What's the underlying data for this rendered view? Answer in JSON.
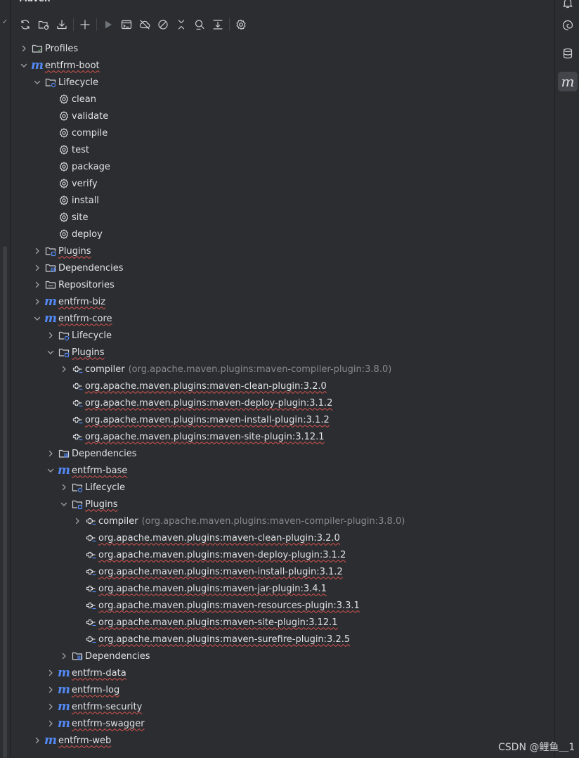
{
  "panel": {
    "title": "Maven"
  },
  "left_gutter": {
    "mark": "✓"
  },
  "toolbar": {
    "buttons": [
      {
        "name": "reload-all-projects",
        "icon": "reload-icon"
      },
      {
        "name": "generate-sources",
        "icon": "folder-reload-icon"
      },
      {
        "name": "download-sources",
        "icon": "download-icon"
      },
      {
        "name": "add-maven-project",
        "icon": "plus-icon"
      },
      {
        "name": "run-maven-build",
        "icon": "run-icon"
      },
      {
        "name": "execute-maven-goal",
        "icon": "terminal-icon"
      },
      {
        "name": "toggle-offline-mode",
        "icon": "cloud-off-icon"
      },
      {
        "name": "toggle-skip-tests",
        "icon": "skip-icon"
      },
      {
        "name": "collapse-all",
        "icon": "collapse-icon"
      },
      {
        "name": "show-dependencies",
        "icon": "analyze-icon"
      },
      {
        "name": "show-diagram",
        "icon": "diagram-icon"
      },
      {
        "name": "build-tool-settings",
        "icon": "gear-icon"
      }
    ]
  },
  "tree": [
    {
      "level": 0,
      "arrow": "right",
      "icon": "folder-profiles",
      "label": "Profiles",
      "wavy": false
    },
    {
      "level": 0,
      "arrow": "down",
      "icon": "maven",
      "label": "entfrm-boot",
      "wavy": true
    },
    {
      "level": 1,
      "arrow": "down",
      "icon": "folder-lifecycle",
      "label": "Lifecycle",
      "wavy": false
    },
    {
      "level": 2,
      "arrow": "none",
      "icon": "gear",
      "label": "clean",
      "wavy": false
    },
    {
      "level": 2,
      "arrow": "none",
      "icon": "gear",
      "label": "validate",
      "wavy": false
    },
    {
      "level": 2,
      "arrow": "none",
      "icon": "gear",
      "label": "compile",
      "wavy": false
    },
    {
      "level": 2,
      "arrow": "none",
      "icon": "gear",
      "label": "test",
      "wavy": false
    },
    {
      "level": 2,
      "arrow": "none",
      "icon": "gear",
      "label": "package",
      "wavy": false
    },
    {
      "level": 2,
      "arrow": "none",
      "icon": "gear",
      "label": "verify",
      "wavy": false
    },
    {
      "level": 2,
      "arrow": "none",
      "icon": "gear",
      "label": "install",
      "wavy": false
    },
    {
      "level": 2,
      "arrow": "none",
      "icon": "gear",
      "label": "site",
      "wavy": false
    },
    {
      "level": 2,
      "arrow": "none",
      "icon": "gear",
      "label": "deploy",
      "wavy": false
    },
    {
      "level": 1,
      "arrow": "right",
      "icon": "folder-plugins",
      "label": "Plugins",
      "wavy": true
    },
    {
      "level": 1,
      "arrow": "right",
      "icon": "folder-deps",
      "label": "Dependencies",
      "wavy": false
    },
    {
      "level": 1,
      "arrow": "right",
      "icon": "folder-repos",
      "label": "Repositories",
      "wavy": false
    },
    {
      "level": 1,
      "arrow": "right",
      "icon": "maven",
      "label": "entfrm-biz",
      "wavy": true
    },
    {
      "level": 1,
      "arrow": "down",
      "icon": "maven",
      "label": "entfrm-core",
      "wavy": true
    },
    {
      "level": 2,
      "arrow": "right",
      "icon": "folder-lifecycle",
      "label": "Lifecycle",
      "wavy": false
    },
    {
      "level": 2,
      "arrow": "down",
      "icon": "folder-plugins",
      "label": "Plugins",
      "wavy": true
    },
    {
      "level": 3,
      "arrow": "right",
      "icon": "plugin",
      "label": "compiler",
      "hint": "(org.apache.maven.plugins:maven-compiler-plugin:3.8.0)",
      "wavy": false
    },
    {
      "level": 3,
      "arrow": "none",
      "icon": "plugin",
      "label": "org.apache.maven.plugins:maven-clean-plugin:3.2.0",
      "wavy": true
    },
    {
      "level": 3,
      "arrow": "none",
      "icon": "plugin",
      "label": "org.apache.maven.plugins:maven-deploy-plugin:3.1.2",
      "wavy": true
    },
    {
      "level": 3,
      "arrow": "none",
      "icon": "plugin",
      "label": "org.apache.maven.plugins:maven-install-plugin:3.1.2",
      "wavy": true
    },
    {
      "level": 3,
      "arrow": "none",
      "icon": "plugin",
      "label": "org.apache.maven.plugins:maven-site-plugin:3.12.1",
      "wavy": true
    },
    {
      "level": 2,
      "arrow": "right",
      "icon": "folder-deps",
      "label": "Dependencies",
      "wavy": false
    },
    {
      "level": 2,
      "arrow": "down",
      "icon": "maven",
      "label": "entfrm-base",
      "wavy": true
    },
    {
      "level": 3,
      "arrow": "right",
      "icon": "folder-lifecycle",
      "label": "Lifecycle",
      "wavy": false
    },
    {
      "level": 3,
      "arrow": "down",
      "icon": "folder-plugins",
      "label": "Plugins",
      "wavy": true
    },
    {
      "level": 4,
      "arrow": "right",
      "icon": "plugin",
      "label": "compiler",
      "hint": "(org.apache.maven.plugins:maven-compiler-plugin:3.8.0)",
      "wavy": false
    },
    {
      "level": 4,
      "arrow": "none",
      "icon": "plugin",
      "label": "org.apache.maven.plugins:maven-clean-plugin:3.2.0",
      "wavy": true
    },
    {
      "level": 4,
      "arrow": "none",
      "icon": "plugin",
      "label": "org.apache.maven.plugins:maven-deploy-plugin:3.1.2",
      "wavy": true
    },
    {
      "level": 4,
      "arrow": "none",
      "icon": "plugin",
      "label": "org.apache.maven.plugins:maven-install-plugin:3.1.2",
      "wavy": true
    },
    {
      "level": 4,
      "arrow": "none",
      "icon": "plugin",
      "label": "org.apache.maven.plugins:maven-jar-plugin:3.4.1",
      "wavy": true
    },
    {
      "level": 4,
      "arrow": "none",
      "icon": "plugin",
      "label": "org.apache.maven.plugins:maven-resources-plugin:3.3.1",
      "wavy": true
    },
    {
      "level": 4,
      "arrow": "none",
      "icon": "plugin",
      "label": "org.apache.maven.plugins:maven-site-plugin:3.12.1",
      "wavy": true
    },
    {
      "level": 4,
      "arrow": "none",
      "icon": "plugin",
      "label": "org.apache.maven.plugins:maven-surefire-plugin:3.2.5",
      "wavy": true
    },
    {
      "level": 3,
      "arrow": "right",
      "icon": "folder-deps",
      "label": "Dependencies",
      "wavy": false
    },
    {
      "level": 2,
      "arrow": "right",
      "icon": "maven",
      "label": "entfrm-data",
      "wavy": true
    },
    {
      "level": 2,
      "arrow": "right",
      "icon": "maven",
      "label": "entfrm-log",
      "wavy": true
    },
    {
      "level": 2,
      "arrow": "right",
      "icon": "maven",
      "label": "entfrm-security",
      "wavy": true
    },
    {
      "level": 2,
      "arrow": "right",
      "icon": "maven",
      "label": "entfrm-swagger",
      "wavy": true
    },
    {
      "level": 1,
      "arrow": "right",
      "icon": "maven",
      "label": "entfrm-web",
      "wavy": true
    }
  ],
  "right_toolbar": [
    {
      "name": "notifications-button",
      "icon": "bell-icon"
    },
    {
      "name": "ai-assistant-button",
      "icon": "spiral-icon"
    },
    {
      "name": "database-button",
      "icon": "database-icon"
    },
    {
      "name": "maven-button",
      "icon": "maven-icon",
      "glyph": "m",
      "active": true
    }
  ],
  "watermark": "CSDN @鲤鱼＿1"
}
